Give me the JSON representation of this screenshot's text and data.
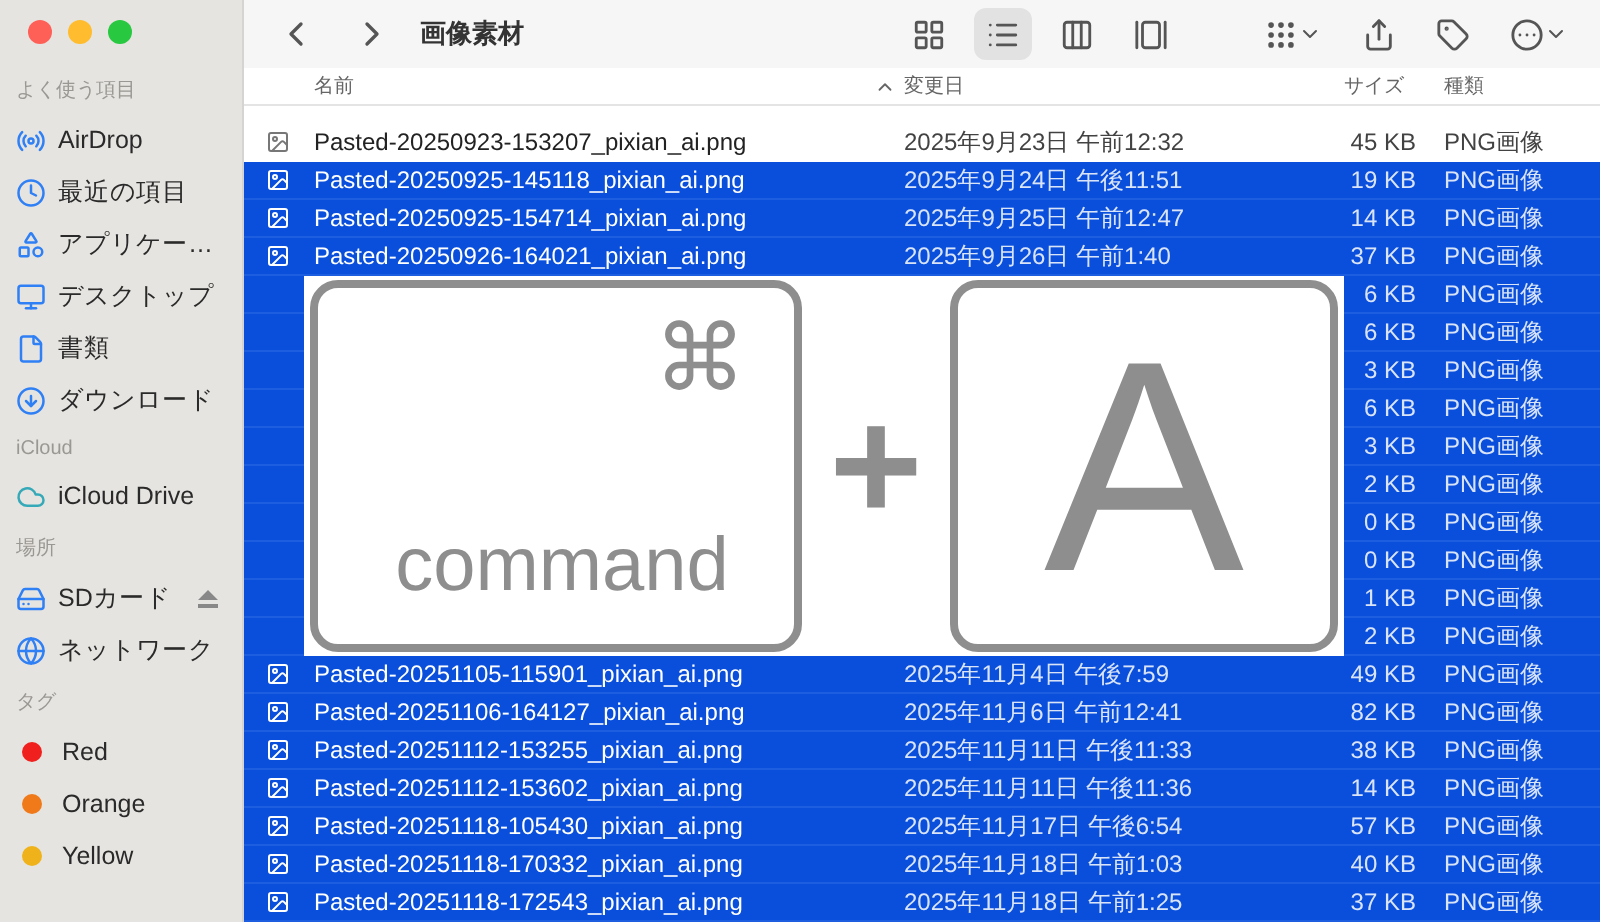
{
  "window": {
    "title": "画像素材"
  },
  "toolbar": {
    "views": [
      {
        "selected": false
      },
      {
        "selected": true
      },
      {
        "selected": false
      },
      {
        "selected": false
      }
    ]
  },
  "sidebar": {
    "sections": [
      {
        "heading": "よく使う項目",
        "items": [
          {
            "label": "AirDrop"
          },
          {
            "label": "最近の項目"
          },
          {
            "label": "アプリケー…"
          },
          {
            "label": "デスクトップ"
          },
          {
            "label": "書類"
          },
          {
            "label": "ダウンロード"
          }
        ]
      },
      {
        "heading": "iCloud",
        "items": [
          {
            "label": "iCloud Drive"
          }
        ]
      },
      {
        "heading": "場所",
        "items": [
          {
            "label": "SDカード",
            "ejectable": true
          },
          {
            "label": "ネットワーク",
            "ejectable": false
          }
        ]
      },
      {
        "heading": "タグ",
        "items": [
          {
            "label": "Red",
            "color": "#f0201f"
          },
          {
            "label": "Orange",
            "color": "#f07a1a"
          },
          {
            "label": "Yellow",
            "color": "#f0b21a"
          }
        ]
      }
    ]
  },
  "table": {
    "columns": [
      {
        "label": "名前",
        "sorted": true
      },
      {
        "label": "変更日",
        "sorted": false
      },
      {
        "label": "サイズ",
        "sorted": false
      },
      {
        "label": "種類",
        "sorted": false
      }
    ],
    "rows": [
      {
        "name": "Pasted-20250923-153207_pixian_ai.png",
        "date": "2025年9月23日 午前12:32",
        "size": "45 KB",
        "kind": "PNG画像",
        "selected": false
      },
      {
        "name": "Pasted-20250925-145118_pixian_ai.png",
        "date": "2025年9月24日 午後11:51",
        "size": "19 KB",
        "kind": "PNG画像",
        "selected": true
      },
      {
        "name": "Pasted-20250925-154714_pixian_ai.png",
        "date": "2025年9月25日 午前12:47",
        "size": "14 KB",
        "kind": "PNG画像",
        "selected": true
      },
      {
        "name": "Pasted-20250926-164021_pixian_ai.png",
        "date": "2025年9月26日 午前1:40",
        "size": "37 KB",
        "kind": "PNG画像",
        "selected": true
      },
      {
        "size": "6 KB",
        "kind": "PNG画像",
        "selected": true
      },
      {
        "size": "6 KB",
        "kind": "PNG画像",
        "selected": true
      },
      {
        "size": "3 KB",
        "kind": "PNG画像",
        "selected": true
      },
      {
        "size": "6 KB",
        "kind": "PNG画像",
        "selected": true
      },
      {
        "size": "3 KB",
        "kind": "PNG画像",
        "selected": true
      },
      {
        "size": "2 KB",
        "kind": "PNG画像",
        "selected": true
      },
      {
        "size": "0 KB",
        "kind": "PNG画像",
        "selected": true
      },
      {
        "size": "0 KB",
        "kind": "PNG画像",
        "selected": true
      },
      {
        "size": "1 KB",
        "kind": "PNG画像",
        "selected": true
      },
      {
        "size": "2 KB",
        "kind": "PNG画像",
        "selected": true
      },
      {
        "name": "Pasted-20251105-115901_pixian_ai.png",
        "date": "2025年11月4日 午後7:59",
        "size": "49 KB",
        "kind": "PNG画像",
        "selected": true
      },
      {
        "name": "Pasted-20251106-164127_pixian_ai.png",
        "date": "2025年11月6日 午前12:41",
        "size": "82 KB",
        "kind": "PNG画像",
        "selected": true
      },
      {
        "name": "Pasted-20251112-153255_pixian_ai.png",
        "date": "2025年11月11日 午後11:33",
        "size": "38 KB",
        "kind": "PNG画像",
        "selected": true
      },
      {
        "name": "Pasted-20251112-153602_pixian_ai.png",
        "date": "2025年11月11日 午後11:36",
        "size": "14 KB",
        "kind": "PNG画像",
        "selected": true
      },
      {
        "name": "Pasted-20251118-105430_pixian_ai.png",
        "date": "2025年11月17日 午後6:54",
        "size": "57 KB",
        "kind": "PNG画像",
        "selected": true
      },
      {
        "name": "Pasted-20251118-170332_pixian_ai.png",
        "date": "2025年11月18日 午前1:03",
        "size": "40 KB",
        "kind": "PNG画像",
        "selected": true
      },
      {
        "name": "Pasted-20251118-172543_pixian_ai.png",
        "date": "2025年11月18日 午前1:25",
        "size": "37 KB",
        "kind": "PNG画像",
        "selected": true
      }
    ]
  },
  "shortcut_overlay": {
    "keys": [
      {
        "symbol": "⌘",
        "label": "command"
      },
      {
        "label": "A"
      }
    ],
    "joiner": "+"
  }
}
